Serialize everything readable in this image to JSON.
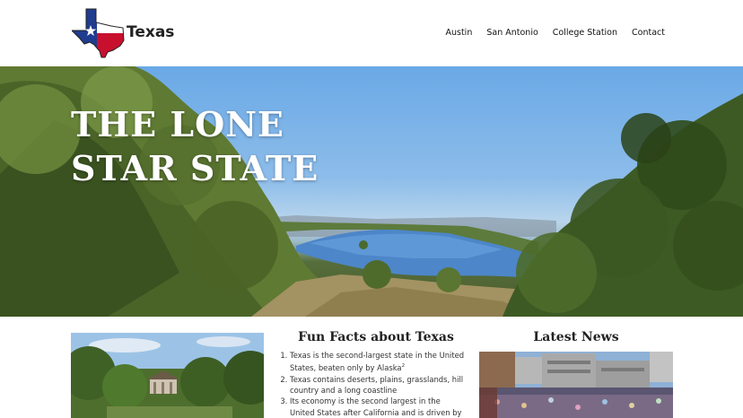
{
  "header": {
    "brand": "Texas",
    "nav": [
      {
        "label": "Austin"
      },
      {
        "label": "San Antonio"
      },
      {
        "label": "College Station"
      },
      {
        "label": "Contact"
      }
    ]
  },
  "hero": {
    "title_line1": "THE LONE",
    "title_line2": "STAR STATE"
  },
  "facts": {
    "heading": "Fun Facts about Texas",
    "items": [
      {
        "text": "Texas is the second-largest state in the United States, beaten only by Alaska",
        "sup": "2"
      },
      {
        "text": "Texas contains deserts, plains, grasslands, hill country and a long coastline"
      },
      {
        "text": "Its economy is the second largest in the United States after California and is driven by"
      }
    ]
  },
  "news": {
    "heading": "Latest News"
  },
  "colors": {
    "flag_blue": "#1f3c8f",
    "flag_red": "#c8102e",
    "hero_sky": "#6aa9e6"
  },
  "icons": {
    "logo": "texas-flag-map-icon"
  }
}
